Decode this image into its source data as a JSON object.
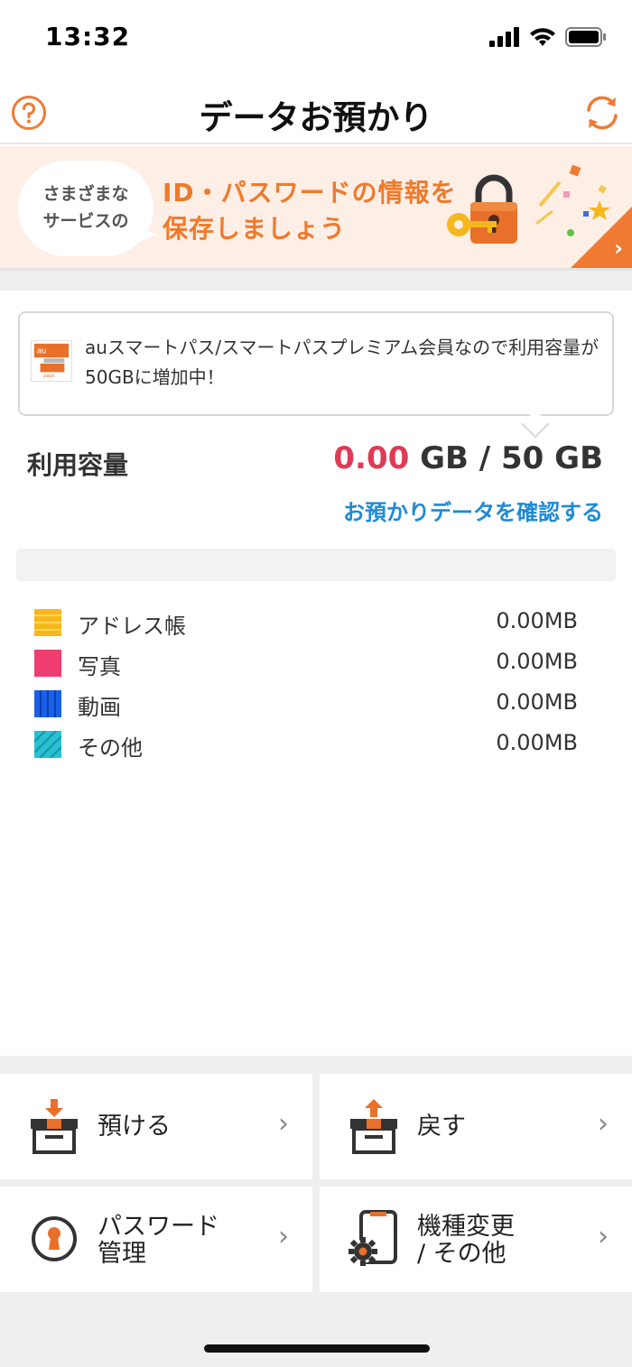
{
  "status_bar": {
    "time": "13:32"
  },
  "header": {
    "title": "データお預かり"
  },
  "banner": {
    "bubble_line1": "さまざまな",
    "bubble_line2": "サービスの",
    "headline_line1": "ID・パスワードの情報を",
    "headline_line2": "保存しましょう"
  },
  "notice": {
    "logo_text": "au",
    "logo_sub": "pass",
    "text": "auスマートパス/スマートパスプレミアム会員なので利用容量が50GBに増加中！"
  },
  "usage": {
    "label": "利用容量",
    "used": "0.00",
    "unit_separator": " GB / 50 GB",
    "confirm_link": "お預かりデータを確認する",
    "used_fraction": 0
  },
  "legend": [
    {
      "label": "アドレス帳",
      "value": "0.00MB",
      "color": "#f5b81c"
    },
    {
      "label": "写真",
      "value": "0.00MB",
      "color": "#ee3d6e"
    },
    {
      "label": "動画",
      "value": "0.00MB",
      "color": "#1a5fe8"
    },
    {
      "label": "その他",
      "value": "0.00MB",
      "color": "#29c0d6"
    }
  ],
  "menu": {
    "backup": "預ける",
    "restore": "戻す",
    "password_line1": "パスワード",
    "password_line2": "管理",
    "device_line1": "機種変更",
    "device_line2": "/ その他",
    "chevron": "›"
  },
  "colors": {
    "accent": "#f07a32",
    "link": "#1f8ad6",
    "used_value": "#e03a56"
  }
}
